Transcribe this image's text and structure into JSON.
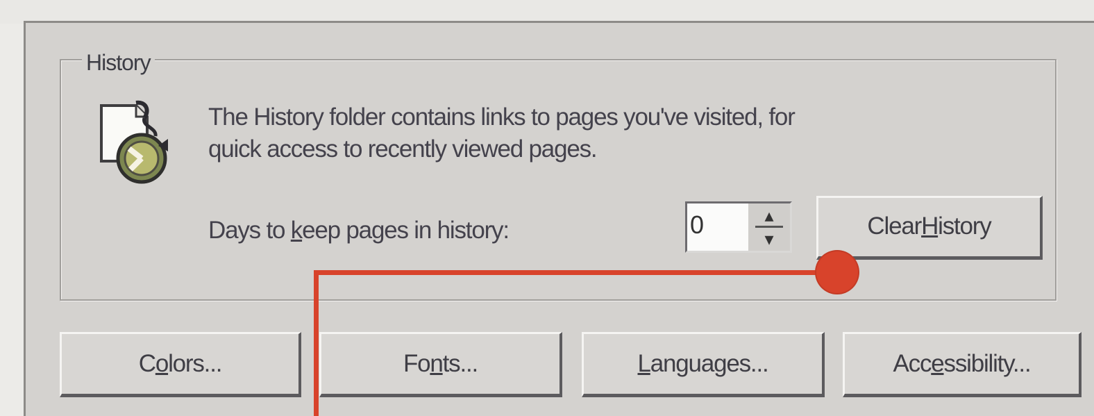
{
  "group": {
    "legend": "History",
    "description_line1": "The History folder contains links to pages you've visited, for",
    "description_line2": "quick access to recently viewed pages.",
    "days_label_pre": "Days to ",
    "days_label_accel": "k",
    "days_label_post": "eep pages in history:",
    "days_value": "0",
    "clear_pre": "Clear ",
    "clear_accel": "H",
    "clear_post": "istory"
  },
  "buttons": {
    "colors_pre": "C",
    "colors_accel": "o",
    "colors_post": "lors...",
    "fonts_pre": "Fo",
    "fonts_accel": "n",
    "fonts_post": "ts...",
    "languages_accel": "L",
    "languages_post": "anguages...",
    "accessibility_pre": "Acc",
    "accessibility_accel": "e",
    "accessibility_post": "ssibility..."
  },
  "icons": {
    "history": "history-folder-clock-icon",
    "spin_up": "spin-up-arrow-icon",
    "spin_down": "spin-down-arrow-icon"
  },
  "colors": {
    "dialog_bg": "#d4d2cf",
    "callout": "#d8432b",
    "text": "#44424c"
  }
}
